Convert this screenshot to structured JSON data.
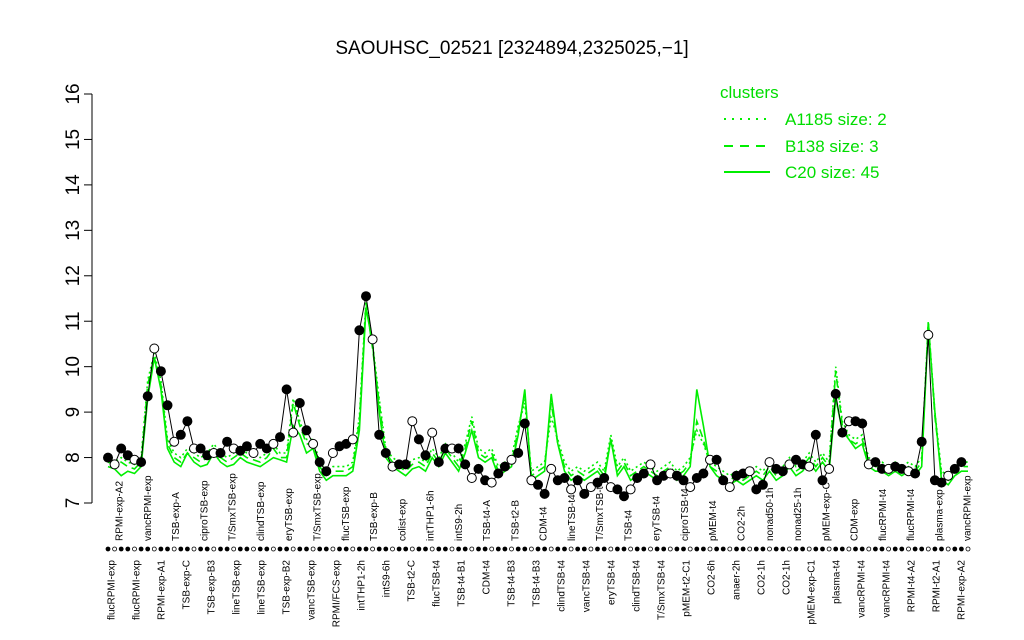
{
  "chart_data": {
    "type": "line",
    "title": "SAOUHSC_02521 [2324894,2325025,−1]",
    "ylim": [
      7,
      16
    ],
    "y_ticks": [
      "7",
      "8",
      "9",
      "10",
      "11",
      "12",
      "13",
      "14",
      "15",
      "16"
    ],
    "legend": {
      "title": "clusters",
      "entries": [
        {
          "label": "A1185 size: 2",
          "style": "dotted"
        },
        {
          "label": "B138 size: 3",
          "style": "dashed"
        },
        {
          "label": "C20 size: 45",
          "style": "solid"
        }
      ],
      "color": "#00ee00"
    },
    "colors": {
      "series": "#00ee00",
      "points": "#000000"
    },
    "bottom_labels": [
      "flucRPMI-exp",
      "flucRPMI-exp",
      "RPMI-exp-A1",
      "TSB-exp-C",
      "TSB-exp-B3",
      "lineTSB-exp",
      "lineTSB-exp",
      "TSB-exp-B2",
      "vancTSB-exp",
      "RPMI/FCS-exp",
      "intTHP1-2h",
      "intS9-6h",
      "TSB-t2-C",
      "flucTSB-t4",
      "TSB-t4-B1",
      "CDM-t4",
      "TSB-t4-B3",
      "TSB-t4-B3",
      "clindTSB-t4",
      "vancTSB-t4",
      "eryTSB-t4",
      "clindTSB-t4",
      "T/SmxTSB-t4",
      "pMEM-t2-C1",
      "CO2-6h",
      "anaer-2h",
      "CO2-1h",
      "CO2-1h",
      "pMEM-exp-C1",
      "plasma-t4",
      "vancRPMI-t4",
      "vancRPMI-t4",
      "RPMI-t4-A2",
      "RPMI-t2-A1",
      "RPMI-exp-A2"
    ],
    "top_labels": [
      "RPMI-exp-A2",
      "vancRPMI-exp",
      "TSB-exp-A",
      "ciproTSB-exp",
      "T/SmxTSB-exp",
      "clindTSB-exp",
      "eryTSB-exp",
      "T/SmxTSB-exp",
      "flucTSB-exp",
      "TSB-exp-B",
      "colist-exp",
      "intTHP1-6h",
      "intS9-2h",
      "TSB-t4-A",
      "TSB-t2-B",
      "CDM-t4",
      "lineTSB-t4",
      "T/SmxTSB-t4",
      "TSB-t4",
      "eryTSB-t4",
      "ciproTSB-t4",
      "pMEM-t4",
      "CO2-2h",
      "nonad50-1h",
      "nonad25-1h",
      "pMEM-exp-C",
      "CDM-exp",
      "flucRPMI-t4",
      "flucRPMI-t4",
      "plasma-exp",
      "vancRPMI-exp"
    ],
    "series": [
      {
        "name": "C20 size: 45",
        "style": "solid",
        "values": [
          7.8,
          7.75,
          7.6,
          7.7,
          7.65,
          7.8,
          9.3,
          10.2,
          9.5,
          8.2,
          7.9,
          7.8,
          8.1,
          7.9,
          7.8,
          7.85,
          8.1,
          7.9,
          7.8,
          7.85,
          8.0,
          7.9,
          7.85,
          7.8,
          7.9,
          8.0,
          7.95,
          7.9,
          8.7,
          8.5,
          8.1,
          8.2,
          7.7,
          7.5,
          7.6,
          7.6,
          7.6,
          7.7,
          8.6,
          11.3,
          10.5,
          9.0,
          8.0,
          7.8,
          7.7,
          7.6,
          7.75,
          7.8,
          7.7,
          8.0,
          7.8,
          8.1,
          7.9,
          7.7,
          8.1,
          8.6,
          8.0,
          7.9,
          8.0,
          7.6,
          7.7,
          7.8,
          8.5,
          9.5,
          7.5,
          7.6,
          7.7,
          9.4,
          8.3,
          7.7,
          7.5,
          7.6,
          7.5,
          7.6,
          7.7,
          7.5,
          8.4,
          7.6,
          7.8,
          7.5,
          7.6,
          7.7,
          7.6,
          7.5,
          7.6,
          7.7,
          7.5,
          7.6,
          7.8,
          9.5,
          8.7,
          7.8,
          7.6,
          7.5,
          7.4,
          7.5,
          7.4,
          7.5,
          7.6,
          7.5,
          7.7,
          7.5,
          7.6,
          7.8,
          7.6,
          7.7,
          7.9,
          7.7,
          7.9,
          7.7,
          9.3,
          8.6,
          8.4,
          8.2,
          8.3,
          7.8,
          7.7,
          7.7,
          7.6,
          7.7,
          7.6,
          7.7,
          7.6,
          7.8,
          10.9,
          9.0,
          7.5,
          7.4,
          7.6,
          7.7,
          7.7
        ]
      },
      {
        "name": "B138 size: 3",
        "style": "dashed",
        "values": [
          7.9,
          7.85,
          7.9,
          7.8,
          7.75,
          7.9,
          9.6,
          10.2,
          9.6,
          8.3,
          8.0,
          7.9,
          8.1,
          8.0,
          7.9,
          8.0,
          8.2,
          8.0,
          7.9,
          8.0,
          8.1,
          8.0,
          7.95,
          7.9,
          8.0,
          8.2,
          8.0,
          8.0,
          9.2,
          8.7,
          8.3,
          8.3,
          7.8,
          7.6,
          7.7,
          7.7,
          7.7,
          7.8,
          8.8,
          11.4,
          10.4,
          9.2,
          8.1,
          7.9,
          7.8,
          7.7,
          7.85,
          7.9,
          7.8,
          8.1,
          7.9,
          8.2,
          8.0,
          7.8,
          8.2,
          8.8,
          8.1,
          8.0,
          8.1,
          7.7,
          7.8,
          7.9,
          8.6,
          9.4,
          7.6,
          7.7,
          7.8,
          9.2,
          8.3,
          7.8,
          7.6,
          7.7,
          7.6,
          7.7,
          7.8,
          7.6,
          8.4,
          7.7,
          7.9,
          7.6,
          7.7,
          7.8,
          7.7,
          7.6,
          7.7,
          7.8,
          7.6,
          7.7,
          7.9,
          8.8,
          8.4,
          7.8,
          7.7,
          7.6,
          7.5,
          7.6,
          7.5,
          7.6,
          7.7,
          7.6,
          7.8,
          7.6,
          7.7,
          7.9,
          7.7,
          7.8,
          8.0,
          7.8,
          8.0,
          7.8,
          9.9,
          8.7,
          8.4,
          8.3,
          8.4,
          7.9,
          7.8,
          7.8,
          7.7,
          7.8,
          7.7,
          7.8,
          7.7,
          7.9,
          11.0,
          8.9,
          7.6,
          7.5,
          7.7,
          7.8,
          7.8
        ]
      },
      {
        "name": "A1185 size: 2",
        "style": "dotted",
        "values": [
          8.0,
          7.9,
          8.0,
          7.9,
          7.85,
          8.0,
          9.7,
          10.3,
          9.7,
          8.4,
          8.1,
          8.0,
          8.2,
          8.1,
          8.0,
          8.1,
          8.3,
          8.1,
          8.0,
          8.1,
          8.2,
          8.1,
          8.05,
          8.0,
          8.1,
          8.3,
          8.1,
          8.1,
          9.3,
          8.8,
          8.4,
          8.4,
          7.9,
          7.7,
          7.8,
          7.8,
          7.8,
          7.9,
          8.9,
          11.5,
          10.5,
          9.3,
          8.2,
          8.0,
          7.9,
          7.8,
          7.95,
          8.0,
          7.9,
          8.2,
          8.0,
          8.3,
          8.1,
          7.9,
          8.3,
          8.9,
          8.2,
          8.1,
          8.2,
          7.8,
          7.9,
          8.0,
          8.7,
          9.2,
          7.7,
          7.8,
          7.9,
          8.9,
          8.4,
          7.9,
          7.7,
          7.8,
          7.7,
          7.8,
          7.9,
          7.7,
          8.5,
          7.8,
          8.0,
          7.7,
          7.8,
          7.9,
          7.8,
          7.7,
          7.8,
          7.9,
          7.7,
          7.8,
          8.0,
          8.6,
          8.3,
          7.9,
          7.8,
          7.7,
          7.6,
          7.7,
          7.6,
          7.7,
          7.8,
          7.7,
          7.9,
          7.7,
          7.8,
          8.0,
          7.8,
          7.9,
          8.1,
          7.9,
          8.1,
          7.9,
          10.0,
          8.8,
          8.5,
          8.4,
          8.5,
          8.0,
          7.9,
          7.9,
          7.8,
          7.9,
          7.8,
          7.9,
          7.8,
          8.0,
          11.0,
          9.0,
          7.7,
          7.6,
          7.8,
          7.9,
          7.9
        ]
      },
      {
        "name": "",
        "style": "points",
        "values": [
          8.0,
          7.85,
          8.2,
          8.05,
          7.95,
          7.9,
          9.35,
          10.4,
          9.9,
          9.15,
          8.35,
          8.5,
          8.8,
          8.2,
          8.2,
          8.05,
          8.1,
          8.1,
          8.35,
          8.2,
          8.15,
          8.25,
          8.1,
          8.3,
          8.2,
          8.3,
          8.45,
          9.5,
          8.55,
          9.2,
          8.6,
          8.3,
          7.9,
          7.7,
          8.1,
          8.25,
          8.3,
          8.4,
          10.8,
          11.55,
          10.6,
          8.5,
          8.1,
          7.8,
          7.85,
          7.85,
          8.8,
          8.4,
          8.05,
          8.55,
          7.9,
          8.2,
          8.2,
          8.2,
          7.85,
          7.55,
          7.75,
          7.5,
          7.45,
          7.65,
          7.8,
          7.95,
          8.1,
          8.75,
          7.5,
          7.4,
          7.2,
          7.75,
          7.5,
          7.55,
          7.3,
          7.5,
          7.2,
          7.35,
          7.45,
          7.55,
          7.35,
          7.3,
          7.15,
          7.3,
          7.55,
          7.65,
          7.85,
          7.5,
          7.6,
          7.65,
          7.6,
          7.5,
          7.35,
          7.55,
          7.65,
          7.95,
          7.95,
          7.5,
          7.35,
          7.6,
          7.65,
          7.7,
          7.3,
          7.4,
          7.9,
          7.75,
          7.7,
          7.85,
          7.95,
          7.85,
          7.8,
          8.5,
          7.5,
          7.75,
          9.4,
          8.55,
          8.8,
          8.8,
          8.75,
          7.85,
          7.9,
          7.75,
          7.75,
          7.8,
          7.75,
          7.7,
          7.65,
          8.35,
          10.7,
          7.5,
          7.45,
          7.6,
          7.75,
          7.9
        ]
      }
    ]
  }
}
